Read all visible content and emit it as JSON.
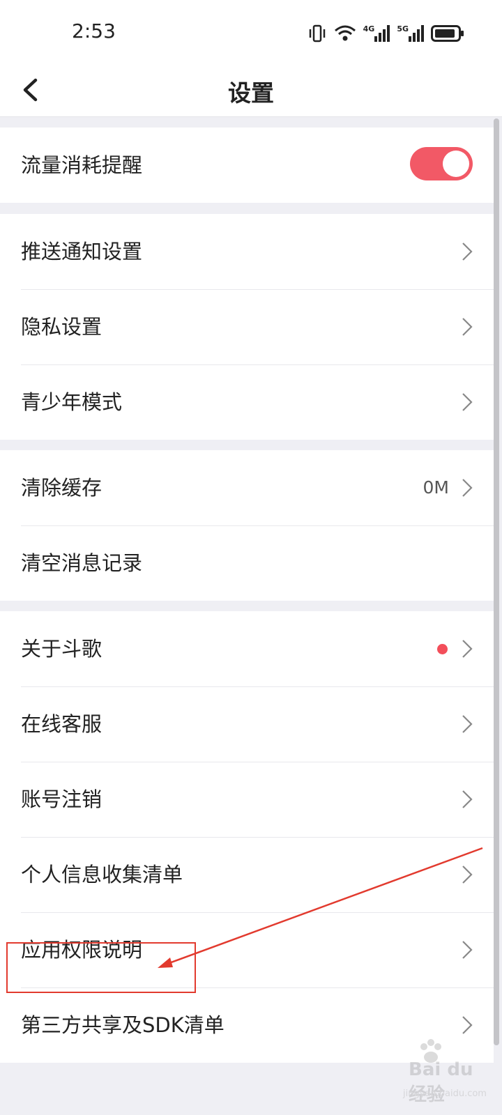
{
  "status": {
    "time": "2:53",
    "net1": "4G",
    "net2": "5G"
  },
  "header": {
    "title": "设置"
  },
  "groups": [
    {
      "items": [
        {
          "label": "流量消耗提醒",
          "toggle_on": true
        }
      ]
    },
    {
      "items": [
        {
          "label": "推送通知设置"
        },
        {
          "label": "隐私设置"
        },
        {
          "label": "青少年模式"
        }
      ]
    },
    {
      "items": [
        {
          "label": "清除缓存",
          "value": "0M"
        },
        {
          "label": "清空消息记录"
        }
      ]
    },
    {
      "items": [
        {
          "label": "关于斗歌",
          "badge": "red-dot"
        },
        {
          "label": "在线客服"
        },
        {
          "label": "账号注销"
        },
        {
          "label": "个人信息收集清单"
        },
        {
          "label": "应用权限说明"
        },
        {
          "label": "第三方共享及SDK清单"
        }
      ]
    }
  ],
  "colors": {
    "accent": "#f25966",
    "annotation": "#e23a2e",
    "badge": "#f34e5a"
  },
  "watermark": {
    "text": "Bai du 经验",
    "sub": "jingyan.baidu.com"
  }
}
